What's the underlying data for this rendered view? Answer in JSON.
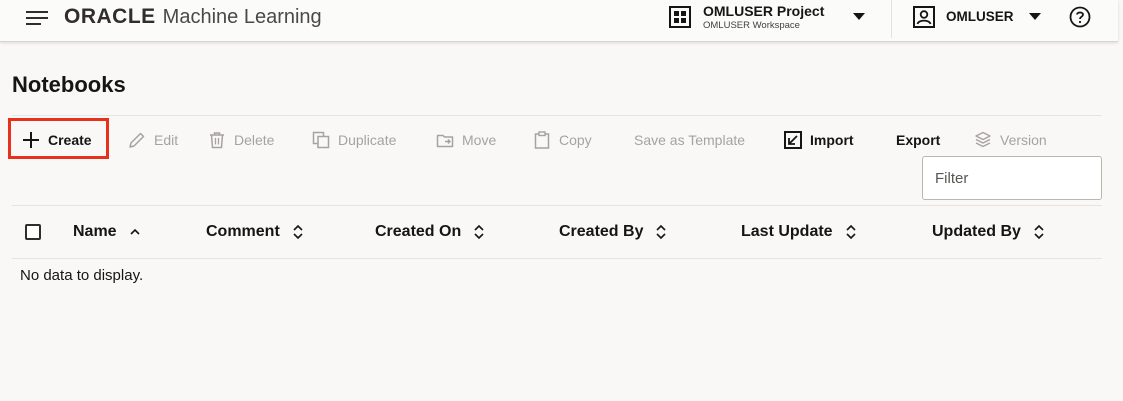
{
  "header": {
    "logo_brand": "ORACLE",
    "logo_product": "Machine Learning",
    "project_name": "OMLUSER Project",
    "workspace_name": "OMLUSER Workspace",
    "user_name": "OMLUSER"
  },
  "page": {
    "title": "Notebooks"
  },
  "toolbar": {
    "create": "Create",
    "edit": "Edit",
    "delete": "Delete",
    "duplicate": "Duplicate",
    "move": "Move",
    "copy": "Copy",
    "save_as_template": "Save as Template",
    "import": "Import",
    "export": "Export",
    "version": "Version"
  },
  "filter": {
    "placeholder": "Filter"
  },
  "table": {
    "columns": {
      "name": "Name",
      "comment": "Comment",
      "created_on": "Created On",
      "created_by": "Created By",
      "last_update": "Last Update",
      "updated_by": "Updated By"
    },
    "empty_message": "No data to display."
  },
  "colors": {
    "highlight_border": "#e7311c",
    "disabled_text": "#a6a39f",
    "text": "#161513",
    "background": "#f9f8f6"
  },
  "icons": {
    "menu": "hamburger-menu-icon",
    "project": "grid-icon",
    "user": "user-icon",
    "help": "help-icon",
    "create": "plus-icon",
    "edit": "pencil-icon",
    "delete": "trash-icon",
    "duplicate": "duplicate-icon",
    "move": "move-icon",
    "copy": "clipboard-icon",
    "import": "import-icon",
    "version": "layers-icon",
    "sort": "sort-icon"
  }
}
